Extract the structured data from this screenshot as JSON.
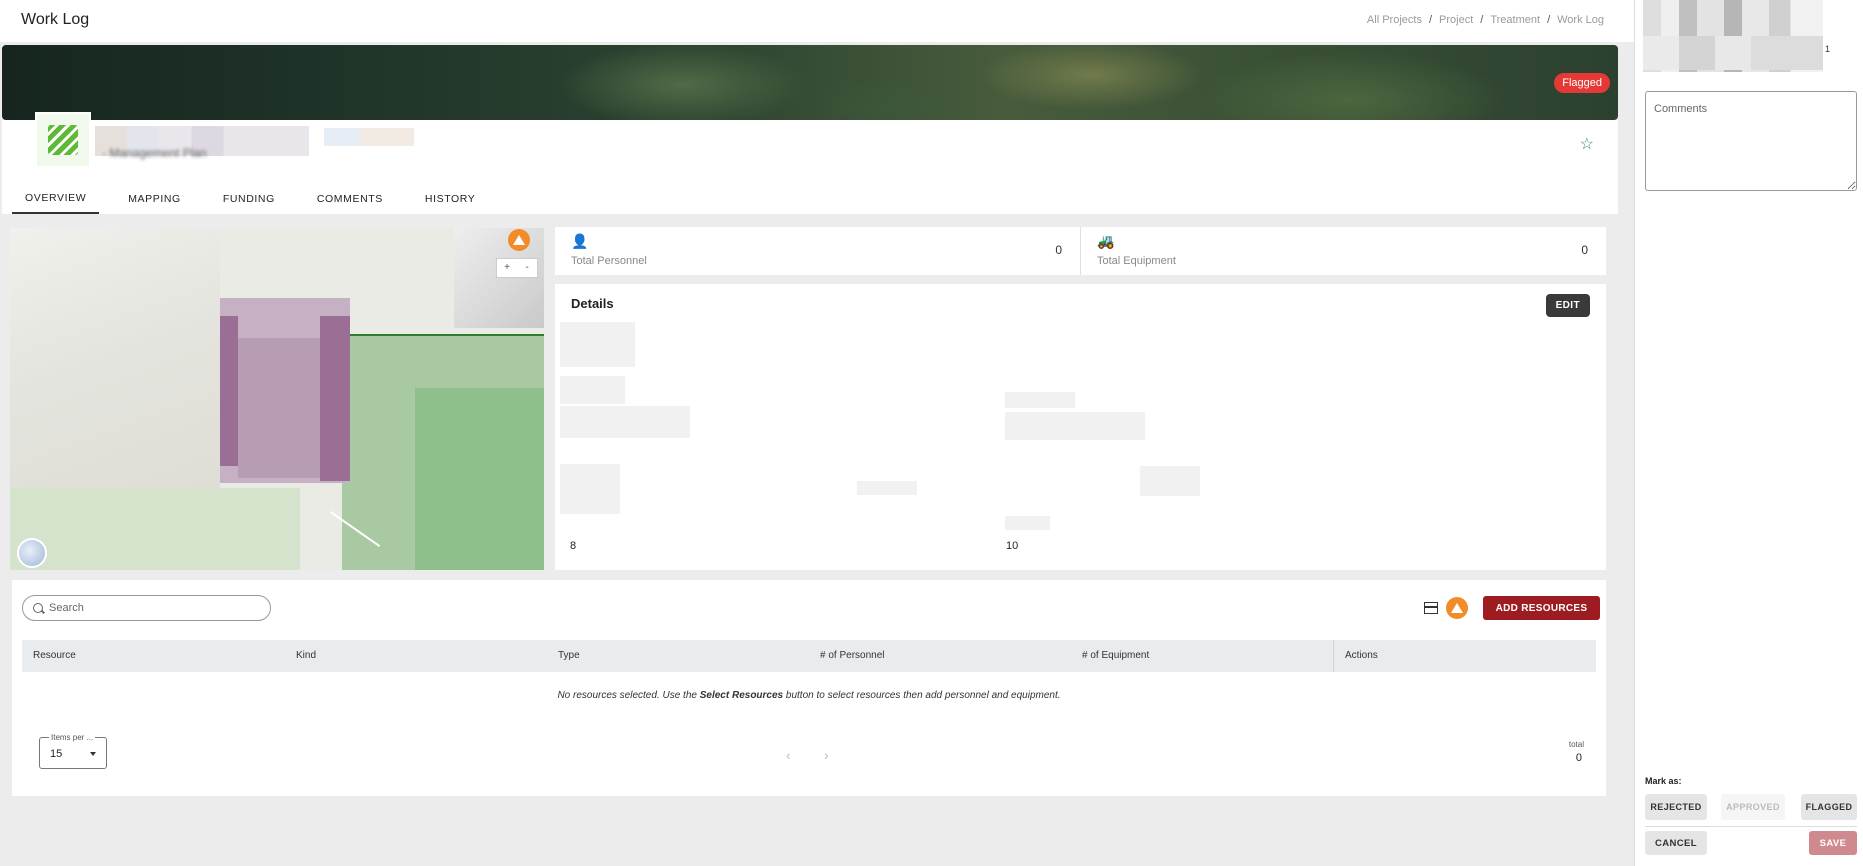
{
  "header": {
    "title": "Work Log",
    "breadcrumb": [
      "All Projects",
      "Project",
      "Treatment",
      "Work Log"
    ],
    "breadcrumb_sep": "/"
  },
  "banner": {
    "badge": "Flagged",
    "badge_color": "#e53935"
  },
  "project": {
    "subtitle_fragment": "- Management Plan"
  },
  "tabs": [
    {
      "label": "OVERVIEW",
      "active": true
    },
    {
      "label": "MAPPING"
    },
    {
      "label": "FUNDING"
    },
    {
      "label": "COMMENTS"
    },
    {
      "label": "HISTORY"
    }
  ],
  "map": {
    "zoom_in": "+",
    "zoom_out": "-"
  },
  "stats": {
    "personnel": {
      "label": "Total Personnel",
      "value": "0",
      "icon": "person-icon"
    },
    "equipment": {
      "label": "Total Equipment",
      "value": "0",
      "icon": "forklift-icon"
    }
  },
  "details": {
    "title": "Details",
    "edit_label": "EDIT",
    "value_left": "8",
    "value_right": "10"
  },
  "resources": {
    "search_placeholder": "Search",
    "add_label": "ADD RESOURCES",
    "columns": [
      "Resource",
      "Kind",
      "Type",
      "# of Personnel",
      "# of Equipment",
      "Actions"
    ],
    "empty_prefix": "No resources selected. Use the ",
    "empty_bold": "Select Resources",
    "empty_suffix": " button to select resources then add personnel and equipment.",
    "items_per_page_label": "Items per ...",
    "items_per_page": "15",
    "prev": "‹",
    "next": "›",
    "total_label": "total",
    "total_value": "0"
  },
  "side": {
    "suffix": "1",
    "comments_placeholder": "Comments",
    "mark_label": "Mark as:",
    "rejected": "REJECTED",
    "approved": "APPROVED",
    "flagged": "FLAGGED",
    "cancel": "CANCEL",
    "save": "SAVE"
  },
  "colors": {
    "accent": "#9c1c22",
    "warning": "#f28c28",
    "brand_green": "#5fb836"
  }
}
